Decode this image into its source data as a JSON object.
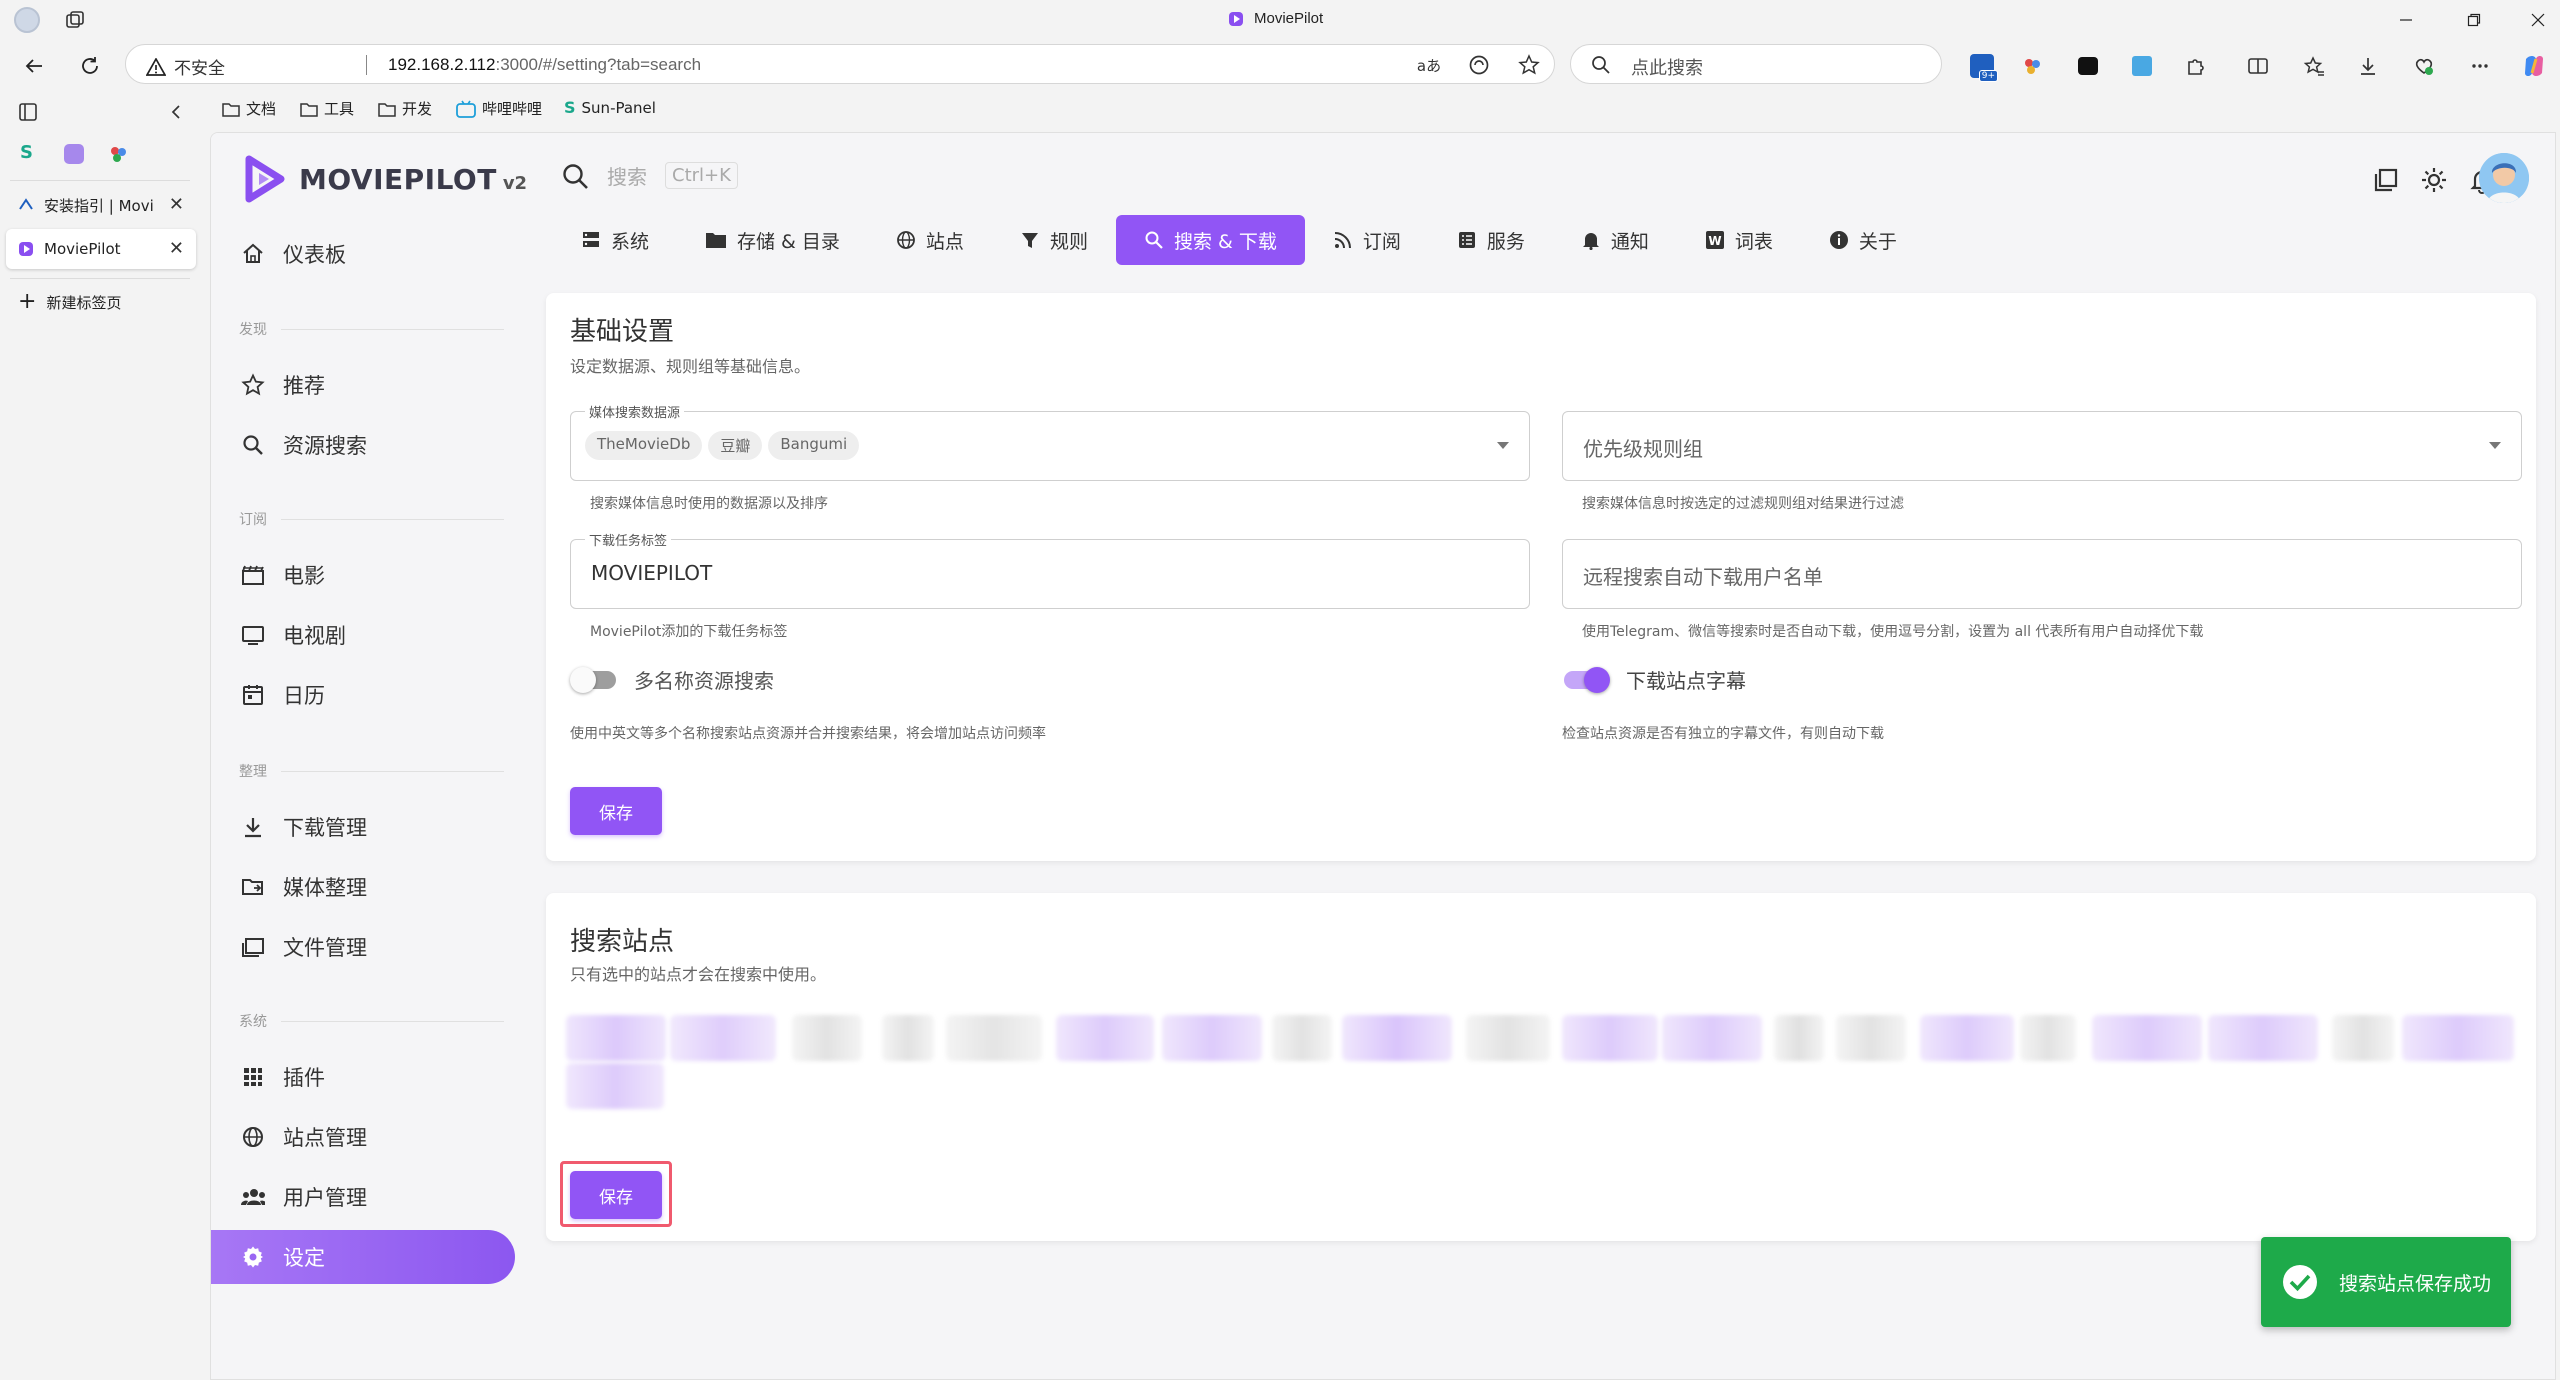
{
  "browser": {
    "window_title": "MoviePilot",
    "security_label": "不安全",
    "url_host": "192.168.2.112",
    "url_path": ":3000/#/setting?tab=search",
    "search_placeholder": "点此搜索",
    "bookmarks": [
      "文档",
      "工具",
      "开发",
      "哔哩哔哩",
      "Sun-Panel"
    ],
    "tabs": [
      {
        "label": "安装指引 | Movi"
      },
      {
        "label": "MoviePilot"
      }
    ],
    "new_tab_label": "新建标签页",
    "ext_badge": "9+"
  },
  "app": {
    "logo_name": "MOVIEPILOT",
    "logo_version": "v2",
    "search_placeholder": "搜索",
    "search_shortcut": "Ctrl+K",
    "accent": "#9155f5"
  },
  "sidebar": {
    "dashboard": "仪表板",
    "sections": {
      "discover": "发现",
      "subscribe": "订阅",
      "organize": "整理",
      "system": "系统"
    },
    "items": {
      "recommend": "推荐",
      "resource_search": "资源搜索",
      "movie": "电影",
      "tv": "电视剧",
      "calendar": "日历",
      "download_mgmt": "下载管理",
      "media_organize": "媒体整理",
      "file_mgmt": "文件管理",
      "plugins": "插件",
      "site_mgmt": "站点管理",
      "user_mgmt": "用户管理",
      "settings": "设定"
    }
  },
  "tabs": [
    "系统",
    "存储 & 目录",
    "站点",
    "规则",
    "搜索 & 下载",
    "订阅",
    "服务",
    "通知",
    "词表",
    "关于"
  ],
  "basic": {
    "title": "基础设置",
    "subtitle": "设定数据源、规则组等基础信息。",
    "media_source_label": "媒体搜索数据源",
    "media_sources": [
      "TheMovieDb",
      "豆瓣",
      "Bangumi"
    ],
    "media_source_hint": "搜索媒体信息时使用的数据源以及排序",
    "priority_placeholder": "优先级规则组",
    "priority_hint": "搜索媒体信息时按选定的过滤规则组对结果进行过滤",
    "download_tag_label": "下载任务标签",
    "download_tag_value": "MOVIEPILOT",
    "download_tag_hint": "MoviePilot添加的下载任务标签",
    "remote_users_placeholder": "远程搜索自动下载用户名单",
    "remote_users_hint": "使用Telegram、微信等搜索时是否自动下载，使用逗号分割，设置为 all 代表所有用户自动择优下载",
    "multi_name_label": "多名称资源搜索",
    "multi_name_on": false,
    "multi_name_hint": "使用中英文等多个名称搜索站点资源并合并搜索结果，将会增加站点访问频率",
    "subtitle_label": "下载站点字幕",
    "subtitle_on": true,
    "subtitle_hint": "检查站点资源是否有独立的字幕文件，有则自动下载",
    "save_label": "保存"
  },
  "sites": {
    "title": "搜索站点",
    "subtitle": "只有选中的站点才会在搜索中使用。",
    "save_label": "保存"
  },
  "toast": {
    "message": "搜索站点保存成功"
  }
}
